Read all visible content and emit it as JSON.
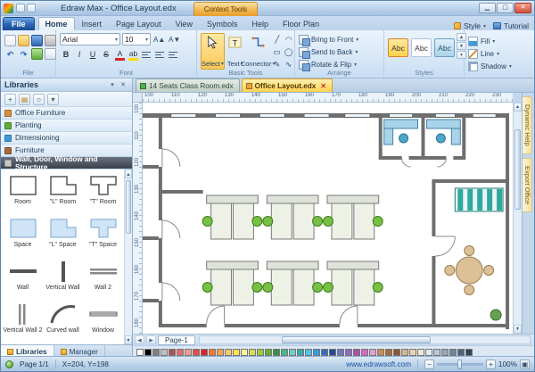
{
  "window": {
    "title": "Edraw Max - Office Layout.edx",
    "context_tools": "Context Tools"
  },
  "icons": {
    "dropdown": "▾",
    "close": "✕",
    "up": "▲",
    "down": "▼",
    "left": "◀",
    "right": "▶",
    "minus": "−",
    "plus": "+",
    "undo": "↶",
    "redo": "↷",
    "scissors": "✂",
    "pencil": "✎"
  },
  "tabs_row": {
    "file": "File",
    "tabs": [
      "Home",
      "Insert",
      "Page Layout",
      "View",
      "Symbols",
      "Help",
      "Floor Plan"
    ],
    "active_tab": "Home",
    "style_btn": "Style",
    "tutorial_btn": "Tutorial"
  },
  "ribbon": {
    "groups": {
      "file_label": "File",
      "font_label": "Font",
      "basic_label": "Basic Tools",
      "arrange_label": "Arrange",
      "styles_label": "Styles"
    },
    "font": {
      "name": "Arial",
      "size": "10",
      "buttons": [
        "B",
        "I",
        "U",
        "S"
      ]
    },
    "basic": {
      "tools": [
        "Select",
        "Text",
        "Connector"
      ],
      "active_tool": "Select"
    },
    "arrange_items": [
      "Bring to Front",
      "Send to Back",
      "Rotate & Flip"
    ],
    "styles_samples": [
      "Abc",
      "Abc",
      "Abc"
    ],
    "effects": [
      "Fill",
      "Line",
      "Shadow"
    ]
  },
  "libraries": {
    "title": "Libraries",
    "sections": [
      {
        "label": "Office Furniture",
        "active": false,
        "icon_color": "#d98c3f"
      },
      {
        "label": "Planting",
        "active": false,
        "icon_color": "#5fae3a"
      },
      {
        "label": "Dimensioning",
        "active": false,
        "icon_color": "#3d9bd9"
      },
      {
        "label": "Furniture",
        "active": false,
        "icon_color": "#a86a3c"
      },
      {
        "label": "Wall, Door, Window and Structure",
        "active": true,
        "icon_color": "#c8c8c8"
      }
    ],
    "shapes": [
      {
        "label": "Room",
        "type": "room"
      },
      {
        "label": "\"L\" Room",
        "type": "l-room"
      },
      {
        "label": "\"T\" Room",
        "type": "t-room"
      },
      {
        "label": "Space",
        "type": "space"
      },
      {
        "label": "\"L\" Space",
        "type": "l-space"
      },
      {
        "label": "\"T\" Space",
        "type": "t-space"
      },
      {
        "label": "Wall",
        "type": "wall"
      },
      {
        "label": "Vertical Wall",
        "type": "v-wall"
      },
      {
        "label": "Wall 2",
        "type": "wall2"
      },
      {
        "label": "Vertical Wall 2",
        "type": "v-wall2"
      },
      {
        "label": "Curved wall",
        "type": "curved-wall"
      },
      {
        "label": "Window",
        "type": "window"
      }
    ],
    "bottom_tabs": [
      {
        "label": "Libraries",
        "active": true
      },
      {
        "label": "Manager",
        "active": false
      }
    ]
  },
  "documents": {
    "tabs": [
      {
        "label": "14 Seats Class Room.edx",
        "active": false,
        "icon_color": "#4caf50"
      },
      {
        "label": "Office Layout.edx",
        "active": true,
        "icon_color": "#e8a33d"
      }
    ],
    "page_tab": "Page-1"
  },
  "rulers": {
    "horizontal": [
      "100",
      "110",
      "120",
      "130",
      "140",
      "150",
      "160",
      "170",
      "180",
      "190",
      "200",
      "210",
      "220",
      "230"
    ],
    "vertical": [
      "100",
      "110",
      "120",
      "130",
      "140",
      "150",
      "160",
      "170",
      "180"
    ]
  },
  "side_tabs": [
    "Dynamic Help",
    "Export Office"
  ],
  "palette": [
    "#ffffff",
    "#000000",
    "#808080",
    "#c0c0c0",
    "#a85454",
    "#e36c6c",
    "#f19c9c",
    "#e94c4c",
    "#d92525",
    "#f2772e",
    "#f9a35b",
    "#fbc664",
    "#ffe34d",
    "#fff59b",
    "#cde05a",
    "#9ccb3b",
    "#5faf3a",
    "#3a8f3e",
    "#46b98c",
    "#6fd0c5",
    "#38a8a8",
    "#4fc3e8",
    "#3d9bd9",
    "#2f6fc1",
    "#27498f",
    "#6a78c9",
    "#8b6bbf",
    "#a94fb0",
    "#d46cc0",
    "#e89cd4",
    "#c58c5a",
    "#a86a3c",
    "#8a5530",
    "#d8b48e",
    "#e8d3b0",
    "#f2e6d0",
    "#dfe8ef",
    "#b8c6d4",
    "#93a7b8",
    "#6e8699",
    "#4a657f",
    "#2f4558"
  ],
  "status": {
    "page": "Page 1/1",
    "coords": "X=204, Y=198",
    "site": "www.edrawsoft.com",
    "zoom": "100%"
  }
}
